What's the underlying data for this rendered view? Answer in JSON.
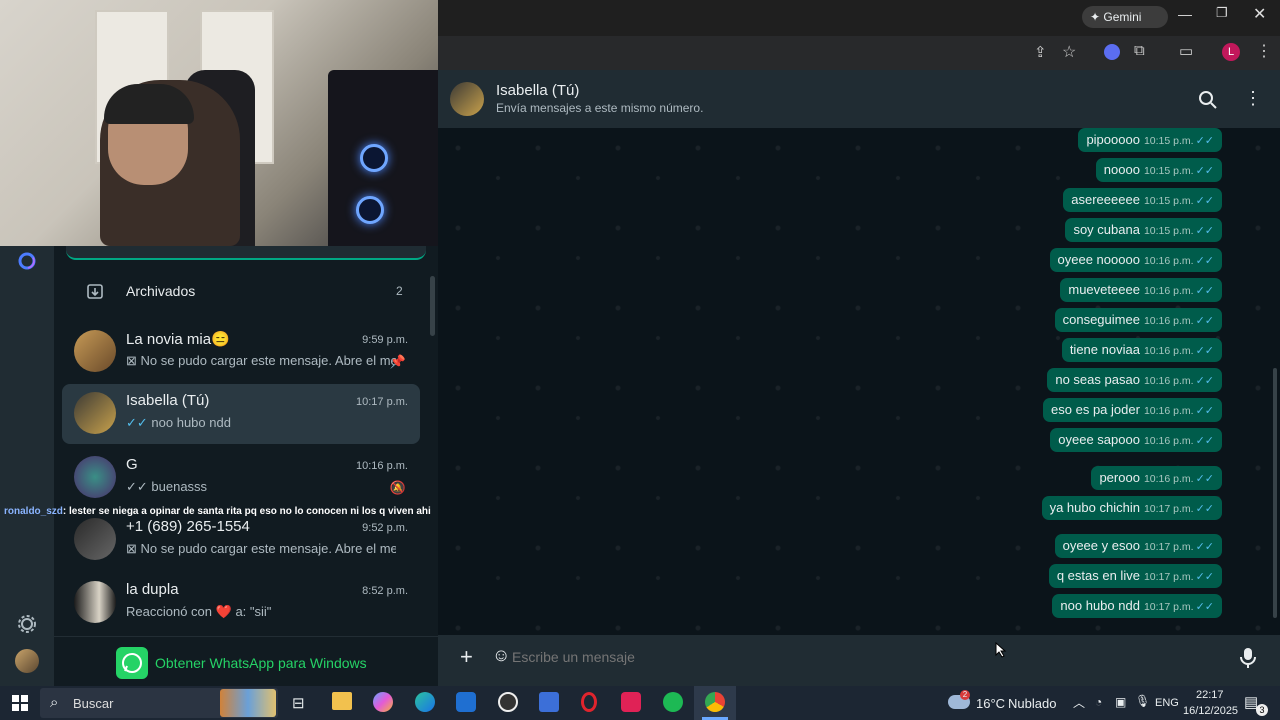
{
  "browser": {
    "gemini_label": "Gemini",
    "profile_initial": "L"
  },
  "sidebar": {
    "archived_label": "Archivados",
    "archived_count": "2",
    "get_whatsapp": "Obtener WhatsApp para Windows",
    "chats": [
      {
        "name": "La novia mia😑",
        "time": "9:59 p.m.",
        "preview": "No se pudo cargar este mensaje. Abre el me...",
        "status_icon": "pin-icon"
      },
      {
        "name": "Isabella (Tú)",
        "time": "10:17 p.m.",
        "preview": "noo hubo ndd",
        "status_icon": ""
      },
      {
        "name": "G",
        "time": "10:16 p.m.",
        "preview": "buenasss",
        "status_icon": "muted-icon"
      },
      {
        "name": "+1 (689) 265-1554",
        "time": "9:52 p.m.",
        "preview": "No se pudo cargar este mensaje. Abre el mensaj...",
        "status_icon": ""
      },
      {
        "name": "la dupla",
        "time": "8:52 p.m.",
        "preview_prefix": "Reaccionó con",
        "preview_suffix": "a: \"sii\"",
        "status_icon": ""
      }
    ]
  },
  "stream_chat": {
    "user": "ronaldo_szd",
    "message": ": lester se niega a opinar de santa rita pq eso no lo conocen ni los q viven ahi"
  },
  "chat": {
    "contact_name": "Isabella (Tú)",
    "contact_subtitle": "Envía mensajes a este mismo número.",
    "composer_placeholder": "Escribe un mensaje",
    "messages": [
      {
        "text": "pipooooo",
        "time": "10:15 p.m."
      },
      {
        "text": "noooo",
        "time": "10:15 p.m."
      },
      {
        "text": "asereeeeee",
        "time": "10:15 p.m."
      },
      {
        "text": "soy cubana",
        "time": "10:15 p.m."
      },
      {
        "text": "oyeee nooooo",
        "time": "10:16 p.m."
      },
      {
        "text": "muevete​eee",
        "time": "10:16 p.m."
      },
      {
        "text": "conseguimee",
        "time": "10:16 p.m."
      },
      {
        "text": "tiene noviaa",
        "time": "10:16 p.m."
      },
      {
        "text": "no seas pasao",
        "time": "10:16 p.m."
      },
      {
        "text": "eso es pa joder",
        "time": "10:16 p.m."
      },
      {
        "text": "oyeee sapooo",
        "time": "10:16 p.m."
      },
      {
        "text": "perooo",
        "time": "10:16 p.m."
      },
      {
        "text": "ya hubo chichin",
        "time": "10:17 p.m."
      },
      {
        "text": "oyeee y esoo",
        "time": "10:17 p.m."
      },
      {
        "text": "q estas en live",
        "time": "10:17 p.m."
      },
      {
        "text": "noo hubo ndd",
        "time": "10:17 p.m."
      }
    ]
  },
  "taskbar": {
    "search_label": "Buscar",
    "weather_temp": "16°C",
    "weather_desc": "Nublado",
    "weather_badge": "2",
    "lang": "ENG",
    "time": "22:17",
    "date": "16/12/2025",
    "notification_count": "3"
  },
  "colors": {
    "accent": "#00a884",
    "bubble_out": "#005c4b",
    "ticks": "#53bdeb"
  }
}
